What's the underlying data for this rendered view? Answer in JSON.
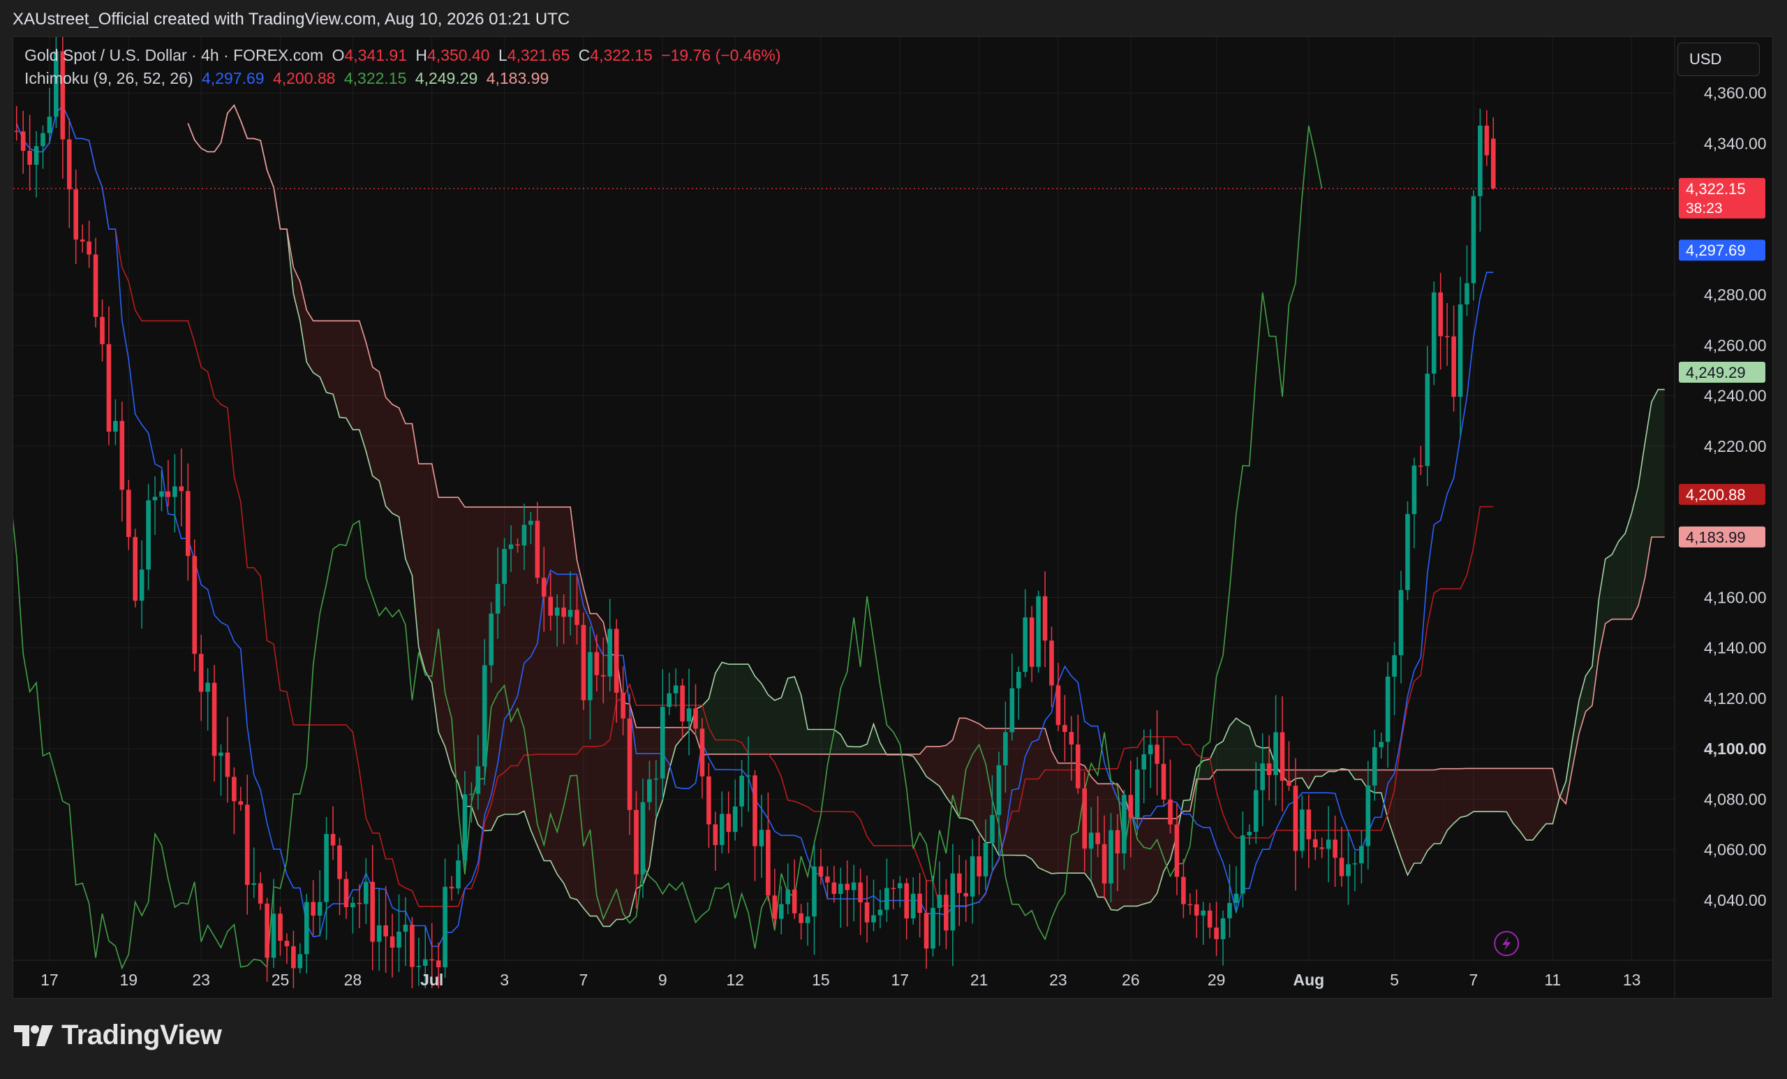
{
  "header": {
    "attribution": "XAUstreet_Official created with TradingView.com, Aug 10, 2026 01:21 UTC"
  },
  "legend": {
    "symbol": "Gold Spot / U.S. Dollar · 4h · FOREX.com",
    "o_label": "O",
    "o_value": "4,341.91",
    "h_label": "H",
    "h_value": "4,350.40",
    "l_label": "L",
    "l_value": "4,321.65",
    "c_label": "C",
    "c_value": "4,322.15",
    "change": "−19.76 (−0.46%)",
    "indicator": "Ichimoku (9, 26, 52, 26)",
    "ind_values": [
      "4,297.69",
      "4,200.88",
      "4,322.15",
      "4,249.29",
      "4,183.99"
    ]
  },
  "currency": "USD",
  "colors": {
    "up": "#089981",
    "down": "#f23645",
    "conversion": "#2962ff",
    "base": "#b71c1c",
    "lagging": "#43a047",
    "lead_a": "#a5d6a7",
    "lead_b": "#ef9a9a",
    "cloud_bull": "rgba(67,160,71,0.12)",
    "cloud_bear": "rgba(244,67,54,0.12)"
  },
  "price_badges": [
    {
      "label": "4,322.15",
      "value": 4322.15,
      "bg": "#22ab4e",
      "fg": "#ffffff"
    },
    {
      "label": "4,322.15",
      "sub": "38:23",
      "value": 4322.15,
      "bg": "#f23645",
      "fg": "#ffffff"
    },
    {
      "label": "4,297.69",
      "value": 4297.69,
      "bg": "#2962ff",
      "fg": "#ffffff"
    },
    {
      "label": "4,249.29",
      "value": 4249.29,
      "bg": "#a5d6a7",
      "fg": "#131722"
    },
    {
      "label": "4,200.88",
      "value": 4200.88,
      "bg": "#b71c1c",
      "fg": "#ffffff"
    },
    {
      "label": "4,183.99",
      "value": 4183.99,
      "bg": "#ef9a9a",
      "fg": "#131722"
    }
  ],
  "footer": {
    "brand": "TradingView"
  },
  "chart_data": {
    "type": "candlestick",
    "title": "Gold Spot / U.S. Dollar · 4h · FOREX.com",
    "ylim": [
      4020,
      4380
    ],
    "y_ticks": [
      {
        "value": 4360,
        "label": "4,360.00"
      },
      {
        "value": 4340,
        "label": "4,340.00"
      },
      {
        "value": 4280,
        "label": "4,280.00"
      },
      {
        "value": 4260,
        "label": "4,260.00"
      },
      {
        "value": 4240,
        "label": "4,240.00"
      },
      {
        "value": 4220,
        "label": "4,220.00"
      },
      {
        "value": 4160,
        "label": "4,160.00"
      },
      {
        "value": 4140,
        "label": "4,140.00"
      },
      {
        "value": 4120,
        "label": "4,120.00"
      },
      {
        "value": 4100,
        "label": "4,100.00",
        "bold": true
      },
      {
        "value": 4080,
        "label": "4,080.00"
      },
      {
        "value": 4060,
        "label": "4,060.00"
      },
      {
        "value": 4040,
        "label": "4,040.00"
      }
    ],
    "x_ticks": [
      {
        "idx": 5,
        "label": "17"
      },
      {
        "idx": 17,
        "label": "19"
      },
      {
        "idx": 28,
        "label": "23"
      },
      {
        "idx": 40,
        "label": "25"
      },
      {
        "idx": 51,
        "label": "28"
      },
      {
        "idx": 63,
        "label": "Jul",
        "bold": true
      },
      {
        "idx": 74,
        "label": "3"
      },
      {
        "idx": 86,
        "label": "7"
      },
      {
        "idx": 98,
        "label": "9"
      },
      {
        "idx": 109,
        "label": "12"
      },
      {
        "idx": 122,
        "label": "15"
      },
      {
        "idx": 134,
        "label": "17"
      },
      {
        "idx": 146,
        "label": "21"
      },
      {
        "idx": 158,
        "label": "23"
      },
      {
        "idx": 169,
        "label": "26"
      },
      {
        "idx": 182,
        "label": "29"
      },
      {
        "idx": 196,
        "label": "Aug",
        "bold": true
      },
      {
        "idx": 209,
        "label": "5"
      },
      {
        "idx": 221,
        "label": "7"
      },
      {
        "idx": 233,
        "label": "11"
      },
      {
        "idx": 245,
        "label": "13"
      }
    ],
    "last_price": 4322.15,
    "anchors": [
      [
        0,
        4345
      ],
      [
        4,
        4340
      ],
      [
        6,
        4375
      ],
      [
        9,
        4310
      ],
      [
        12,
        4270
      ],
      [
        15,
        4220
      ],
      [
        18,
        4160
      ],
      [
        21,
        4200
      ],
      [
        24,
        4210
      ],
      [
        28,
        4130
      ],
      [
        33,
        4080
      ],
      [
        37,
        4030
      ],
      [
        42,
        4020
      ],
      [
        47,
        4060
      ],
      [
        52,
        4040
      ],
      [
        58,
        4020
      ],
      [
        62,
        4010
      ],
      [
        66,
        4040
      ],
      [
        70,
        4100
      ],
      [
        74,
        4190
      ],
      [
        78,
        4180
      ],
      [
        82,
        4160
      ],
      [
        86,
        4130
      ],
      [
        90,
        4140
      ],
      [
        94,
        4060
      ],
      [
        98,
        4110
      ],
      [
        102,
        4120
      ],
      [
        106,
        4060
      ],
      [
        110,
        4100
      ],
      [
        114,
        4040
      ],
      [
        118,
        4030
      ],
      [
        122,
        4060
      ],
      [
        126,
        4045
      ],
      [
        130,
        4035
      ],
      [
        134,
        4040
      ],
      [
        140,
        4030
      ],
      [
        146,
        4060
      ],
      [
        152,
        4140
      ],
      [
        156,
        4150
      ],
      [
        160,
        4090
      ],
      [
        164,
        4050
      ],
      [
        168,
        4070
      ],
      [
        172,
        4100
      ],
      [
        176,
        4050
      ],
      [
        180,
        4040
      ],
      [
        184,
        4030
      ],
      [
        188,
        4080
      ],
      [
        191,
        4100
      ],
      [
        194,
        4070
      ],
      [
        197,
        4050
      ],
      [
        201,
        4060
      ],
      [
        205,
        4075
      ],
      [
        209,
        4150
      ],
      [
        212,
        4200
      ],
      [
        215,
        4270
      ],
      [
        218,
        4250
      ],
      [
        220,
        4280
      ],
      [
        222,
        4345
      ],
      [
        224,
        4322
      ]
    ],
    "series": [
      {
        "name": "Conversion Line",
        "color": "#2962ff",
        "offset": 0,
        "period": 9,
        "last": 4297.69
      },
      {
        "name": "Base Line",
        "color": "#b71c1c",
        "offset": 0,
        "period": 26,
        "last": 4200.88
      },
      {
        "name": "Lagging Span",
        "color": "#43a047",
        "offset": -26,
        "last": 4322.15
      },
      {
        "name": "Leading Span A",
        "color": "#a5d6a7",
        "offset": 26,
        "last": 4249.29
      },
      {
        "name": "Leading Span B",
        "color": "#ef9a9a",
        "offset": 26,
        "period": 52,
        "last": 4183.99
      }
    ]
  }
}
